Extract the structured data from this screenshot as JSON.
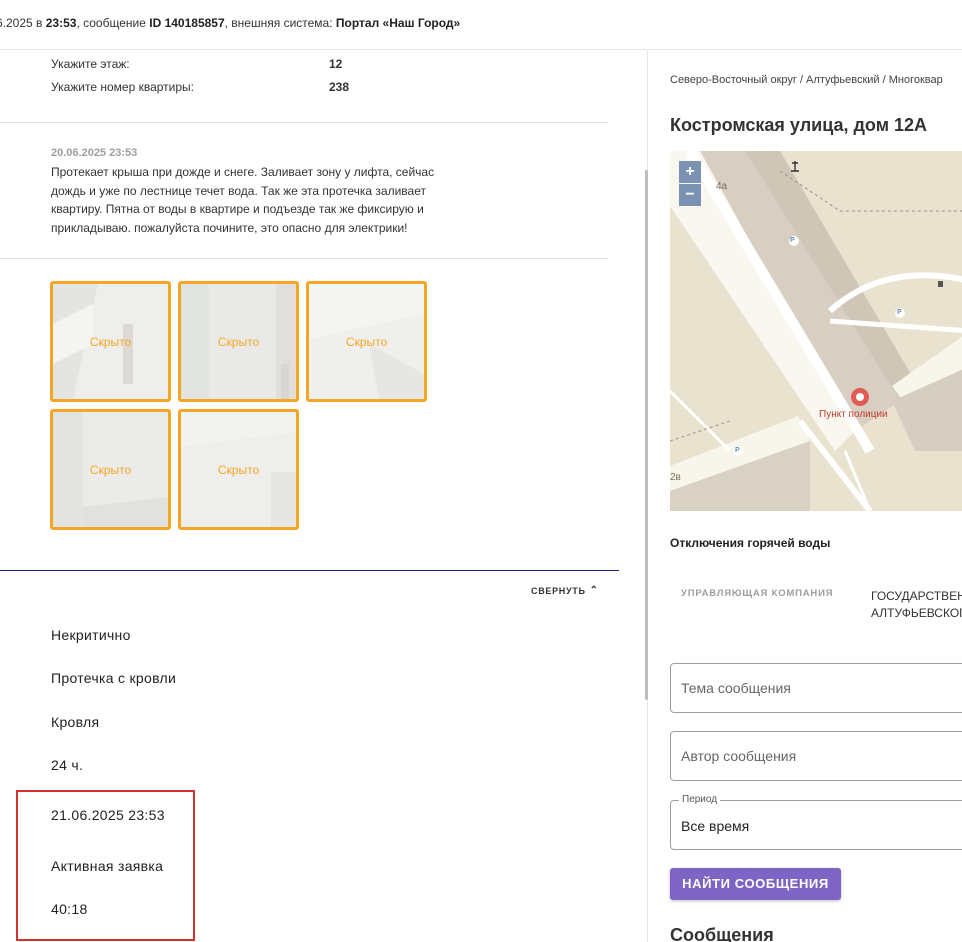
{
  "header": {
    "date_prefix": "6.2025 в ",
    "time": "23:53",
    "msg_prefix": ", сообщение ",
    "msg_id": "ID 140185857",
    "ext_prefix": ", внешняя система: ",
    "ext_system": "Портал «Наш Город»"
  },
  "details": {
    "floor_label": "Укажите этаж:",
    "floor_value": "12",
    "apt_label": "Укажите номер квартиры:",
    "apt_value": "238"
  },
  "message": {
    "date": "20.06.2025 23:53",
    "text": "Протекает крыша при дожде и снеге. Заливает зону у лифта, сейчас дождь и уже по лестнице течет вода. Так же эта протечка заливает квартиру. Пятна от воды в квартире и подъезде так же фиксирую и прикладываю. пожалуйста почините, это опасно для электрики!"
  },
  "photos": [
    {
      "caption": "Скрыто"
    },
    {
      "caption": "Скрыто"
    },
    {
      "caption": "Скрыто"
    },
    {
      "caption": "Скрыто"
    },
    {
      "caption": "Скрыто"
    }
  ],
  "collapse_label": "СВЕРНУТЬ",
  "fields": {
    "criticality": "Некритично",
    "problem": "Протечка с кровли",
    "category": "Кровля",
    "deadline": "24 ч.",
    "due_date": "21.06.2025 23:53",
    "status": "Активная заявка",
    "timer": "40:18"
  },
  "right": {
    "breadcrumbs": "Северо-Восточный округ / Алтуфьевский / Многоквар",
    "address": "Костромская улица, дом 12А",
    "map": {
      "zoom_in": "+",
      "zoom_out": "−",
      "label_4a": "4а",
      "label_2v": "2в",
      "poi": "Пункт полиции",
      "parking": "P"
    },
    "hot_water_title": "Отключения горячей воды",
    "uk_label": "УПРАВЛЯЮЩАЯ КОМПАНИЯ",
    "uk_value_1": "ГОСУДАРСТВЕН",
    "uk_value_2": "АЛТУФЬЕВСКОГ",
    "subject_placeholder": "Тема сообщения",
    "author_placeholder": "Автор сообщения",
    "period_label": "Период",
    "period_value": "Все время",
    "find_button": "НАЙТИ СООБЩЕНИЯ",
    "messages_heading": "Сообщения"
  },
  "colors": {
    "accent_orange": "#f5a623",
    "button_purple": "#7e64c4",
    "highlight_red": "#d32f2f",
    "divider_navy": "#1a237e"
  }
}
